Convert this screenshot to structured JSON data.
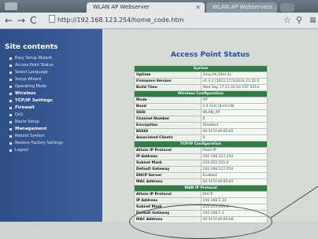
{
  "browser": {
    "tabs": [
      {
        "label": "WLAN AP Webserver"
      },
      {
        "label": "WLAN AP Webserver"
      }
    ],
    "url": "http://192.168.123.254/home_code.htm"
  },
  "sidebar": {
    "title": "Site contents",
    "items": [
      {
        "label": "Easy Setup Wizard",
        "bold": false
      },
      {
        "label": "Access Point Status",
        "bold": false
      },
      {
        "label": "Select Language",
        "bold": false
      },
      {
        "label": "Setup Wizard",
        "bold": false
      },
      {
        "label": "Operating Mode",
        "bold": false
      },
      {
        "label": "Wireless",
        "bold": true
      },
      {
        "label": "TCP/IP Settings",
        "bold": true
      },
      {
        "label": "Firewall",
        "bold": true
      },
      {
        "label": "QoS",
        "bold": false
      },
      {
        "label": "Route Setup",
        "bold": false
      },
      {
        "label": "Management",
        "bold": true
      },
      {
        "label": "Reboot System",
        "bold": false
      },
      {
        "label": "Restore Factory Settings",
        "bold": false
      },
      {
        "label": "Logout",
        "bold": false
      }
    ]
  },
  "main": {
    "title": "Access Point Status",
    "rows": [
      {
        "type": "section",
        "label": "System"
      },
      {
        "type": "row",
        "label": "Uptime",
        "value": "0day:0h:29m:3s"
      },
      {
        "type": "row",
        "label": "Firmware Version",
        "value": "v1.4.2 (1012.17/1/2014 21:32:2"
      },
      {
        "type": "row",
        "label": "Build Time",
        "value": "Wed Sep 17 21:32:02 CST 2014"
      },
      {
        "type": "section",
        "label": "Wireless Configuration"
      },
      {
        "type": "row",
        "label": "Mode",
        "value": "AP"
      },
      {
        "type": "row",
        "label": "Band",
        "value": "2.4 GHz (B+G+N)"
      },
      {
        "type": "row",
        "label": "SSID",
        "value": "WLAN_AP"
      },
      {
        "type": "row",
        "label": "Channel Number",
        "value": "6"
      },
      {
        "type": "row",
        "label": "Encryption",
        "value": "Disabled"
      },
      {
        "type": "row",
        "label": "BSSID",
        "value": "00:1f:1f:a0:00:b5"
      },
      {
        "type": "row",
        "label": "Associated Clients",
        "value": "0"
      },
      {
        "type": "section",
        "label": "TCP/IP Configuration"
      },
      {
        "type": "row",
        "label": "Attain IP Protocol",
        "value": "Fixed IP"
      },
      {
        "type": "row",
        "label": "IP Address",
        "value": "192.168.123.254"
      },
      {
        "type": "row",
        "label": "Subnet Mask",
        "value": "255.255.255.0"
      },
      {
        "type": "row",
        "label": "Default Gateway",
        "value": "192.168.123.254"
      },
      {
        "type": "row",
        "label": "DHCP Server",
        "value": "Enabled"
      },
      {
        "type": "row",
        "label": "MAC Address",
        "value": "00:1f:1f:a0:00:b5"
      },
      {
        "type": "section",
        "label": "WAN IP Protocol"
      },
      {
        "type": "row",
        "label": "Attain IP Protocol",
        "value": "DHCP"
      },
      {
        "type": "row",
        "label": "IP Address",
        "value": "192.168.1.33"
      },
      {
        "type": "row",
        "label": "Subnet Mask",
        "value": "255.255.255.0"
      },
      {
        "type": "row",
        "label": "Default Gateway",
        "value": "192.168.1.1"
      },
      {
        "type": "row",
        "label": "MAC Address",
        "value": "00:1f:1f:a0:00:b6"
      }
    ]
  },
  "colors": {
    "sidebar_bg": "#34558f",
    "section_header": "#2e7d46",
    "title_blue": "#1f4fa0"
  }
}
